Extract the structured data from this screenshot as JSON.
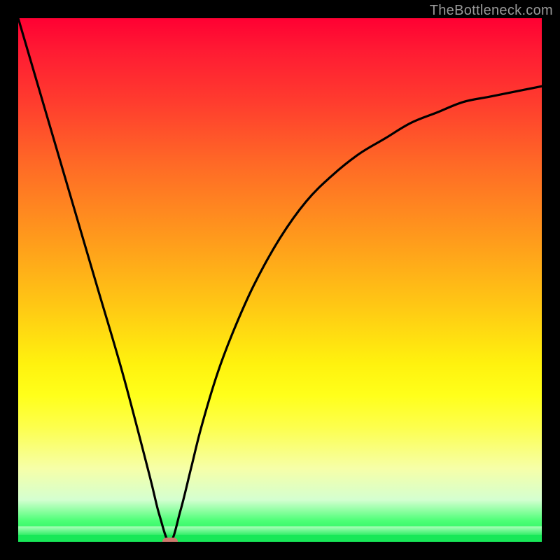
{
  "watermark": "TheBottleneck.com",
  "colors": {
    "frame": "#000000",
    "curve": "#000000",
    "marker": "#ce7a6d",
    "gradient_top": "#ff0033",
    "gradient_bottom": "#18e858"
  },
  "chart_data": {
    "type": "line",
    "title": "",
    "xlabel": "",
    "ylabel": "",
    "xlim": [
      0,
      100
    ],
    "ylim": [
      0,
      100
    ],
    "grid": false,
    "legend": false,
    "optimum_x": 29,
    "marker": {
      "x": 29,
      "y": 0
    },
    "series": [
      {
        "name": "bottleneck-curve",
        "x": [
          0,
          5,
          10,
          15,
          20,
          25,
          27,
          29,
          31,
          33,
          35,
          38,
          41,
          45,
          50,
          55,
          60,
          65,
          70,
          75,
          80,
          85,
          90,
          95,
          100
        ],
        "y": [
          100,
          83,
          66,
          49,
          32,
          13,
          5,
          0,
          6,
          14,
          22,
          32,
          40,
          49,
          58,
          65,
          70,
          74,
          77,
          80,
          82,
          84,
          85,
          86,
          87
        ]
      }
    ]
  }
}
